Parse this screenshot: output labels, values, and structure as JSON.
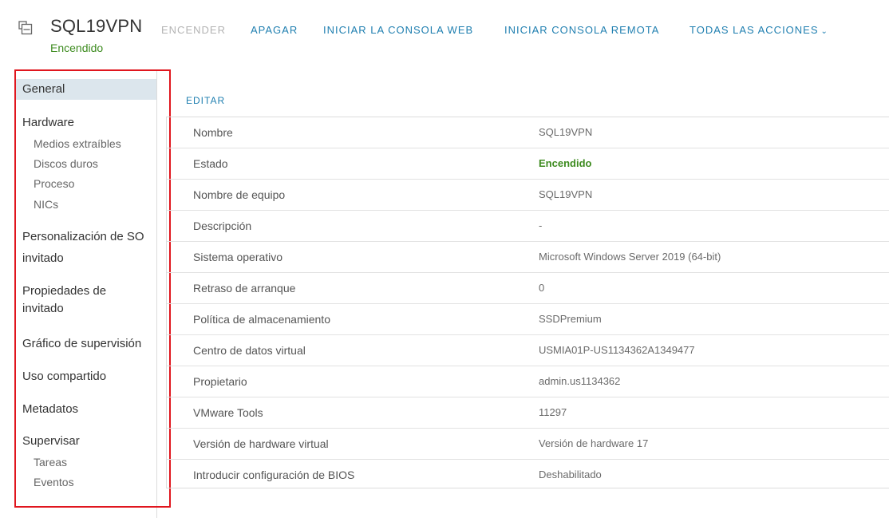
{
  "header": {
    "vm_name": "SQL19VPN",
    "vm_status": "Encendido",
    "icon": "vm-icon",
    "actions": {
      "power_on": "ENCENDER",
      "power_off": "APAGAR",
      "web_console": "INICIAR LA CONSOLA WEB",
      "remote_console": "INICIAR CONSOLA REMOTA",
      "all_actions": "TODAS LAS ACCIONES"
    }
  },
  "sidebar": {
    "general": "General",
    "hardware": "Hardware",
    "hardware_items": [
      "Medios extraíbles",
      "Discos duros",
      "Proceso",
      "NICs"
    ],
    "os_customization_1": "Personalización de SO",
    "os_customization_2": "invitado",
    "guest_props_1": "Propiedades de",
    "guest_props_2": "invitado",
    "monitoring_graph": "Gráfico de supervisión",
    "sharing": "Uso compartido",
    "metadata": "Metadatos",
    "monitor": "Supervisar",
    "monitor_items": [
      "Tareas",
      "Eventos"
    ]
  },
  "main": {
    "edit_label": "EDITAR",
    "rows": [
      {
        "key": "Nombre",
        "value": "SQL19VPN"
      },
      {
        "key": "Estado",
        "value": "Encendido"
      },
      {
        "key": "Nombre de equipo",
        "value": "SQL19VPN"
      },
      {
        "key": "Descripción",
        "value": "-"
      },
      {
        "key": "Sistema operativo",
        "value": "Microsoft Windows Server 2019 (64-bit)"
      },
      {
        "key": "Retraso de arranque",
        "value": "0"
      },
      {
        "key": "Política de almacenamiento",
        "value": "SSDPremium"
      },
      {
        "key": "Centro de datos virtual",
        "value": "USMIA01P-US1134362A1349477"
      },
      {
        "key": "Propietario",
        "value": "admin.us1134362"
      },
      {
        "key": "VMware Tools",
        "value": "11297"
      },
      {
        "key": "Versión de hardware virtual",
        "value": "Versión de hardware 17"
      },
      {
        "key": "Introducir configuración de BIOS",
        "value": "Deshabilitado"
      }
    ]
  },
  "colors": {
    "accent": "#1f7fb0",
    "status_green": "#3d8b1f",
    "highlight_border": "#e0161e",
    "active_bg": "#dce6ed"
  }
}
